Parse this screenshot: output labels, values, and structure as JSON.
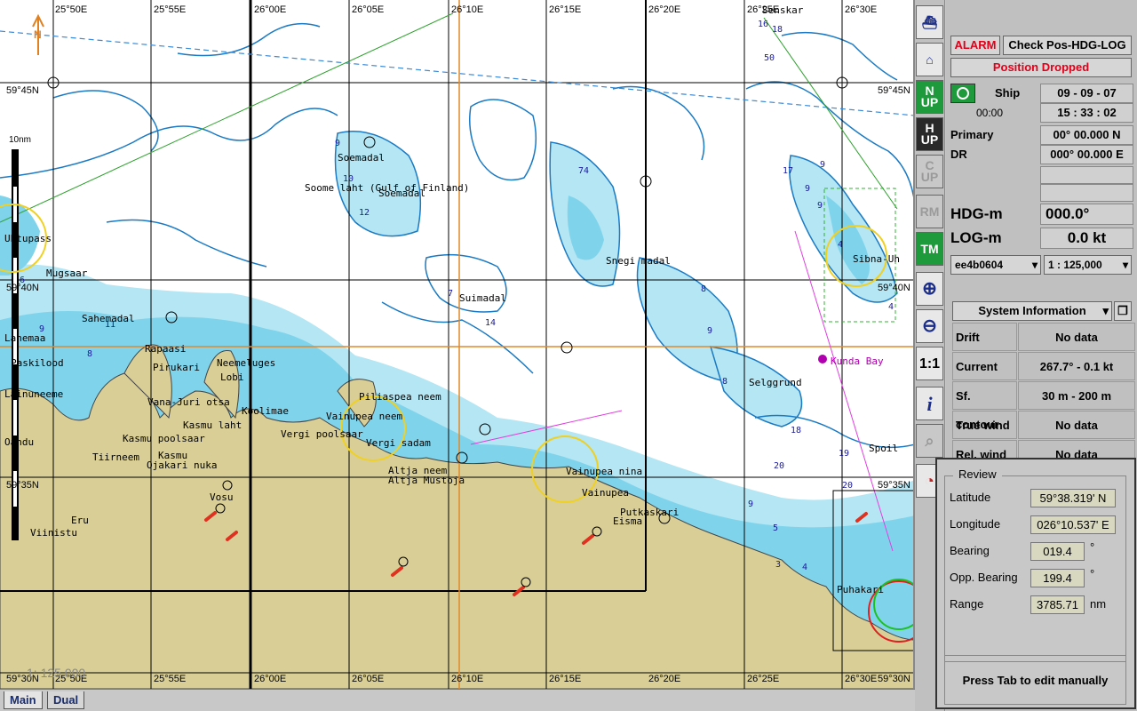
{
  "chart": {
    "top_longitudes": [
      "25°50E",
      "25°55E",
      "26°00E",
      "26°05E",
      "26°10E",
      "26°15E",
      "26°20E",
      "26°25E",
      "26°30E"
    ],
    "bottom_longitudes": [
      "25°50E",
      "25°55E",
      "26°00E",
      "26°05E",
      "26°10E",
      "26°15E",
      "26°20E",
      "26°25E",
      "26°30E"
    ],
    "left_latitudes": [
      "59°45N",
      "59°40N",
      "59°35N",
      "59°30N"
    ],
    "right_latitudes": [
      "59°45N",
      "59°40N",
      "59°35N",
      "59°30N"
    ],
    "scale_bar_label": "10nm",
    "scale_text": "1: 125,000",
    "places": [
      "Soemadal",
      "Soome laht (Gulf of Finland)",
      "Soemadal",
      "Snegi madal",
      "Suimadal",
      "Kunda Bay",
      "Selggrund",
      "Spoil",
      "Sibna-Uh",
      "Uhtupass",
      "Mugsaar",
      "Sahemadal",
      "Paskilood",
      "Rapaasi",
      "Pirukari",
      "Kasmu laht",
      "Kasmu poolsaar",
      "Neemeluges",
      "Lobi",
      "Vainupea neem",
      "Vergi poolsaar",
      "Vergi sadam",
      "Altja neem",
      "Altja Mustoja",
      "Vainupea nina",
      "Vainupea",
      "Putkaskari",
      "Eisma",
      "Puhakari",
      "Viinistu",
      "Tiirneem",
      "Ojakari nuka",
      "Vosu",
      "Eru",
      "Kasmu",
      "Lainuneeme",
      "Vana-Juri otsa",
      "Koolimae",
      "Piliaspea neem",
      "Lahemaa",
      "Oandu",
      "Senskar"
    ],
    "depths": [
      "16",
      "18",
      "50",
      "9",
      "10",
      "12",
      "74",
      "17",
      "4",
      "9",
      "8",
      "7",
      "14",
      "9",
      "8",
      "9",
      "4",
      "20",
      "19",
      "20",
      "18",
      "5",
      "3",
      "4",
      "9",
      "9",
      "11",
      "8",
      "9",
      "6"
    ]
  },
  "tabs": {
    "main": "Main",
    "dual": "Dual"
  },
  "tools": {
    "n_up": "N UP",
    "h_up": "H UP",
    "c_up": "C UP",
    "rm": "RM",
    "tm": "TM",
    "one_to_one": "1:1",
    "info": "i"
  },
  "panel": {
    "alarm_label": "ALARM",
    "alarm_message": "Check Pos-HDG-LOG",
    "position_status": "Position Dropped",
    "ship_label": "Ship",
    "ship_time_offset": "00:00",
    "date": "09 - 09 - 07",
    "time": "15 : 33 : 02",
    "primary_label": "Primary",
    "primary_value": "00° 00.000 N",
    "dr_label": "DR",
    "dr_value": "000° 00.000 E",
    "hdg_label": "HDG-m",
    "hdg_value": "000.0°",
    "log_label": "LOG-m",
    "log_value": "0.0 kt",
    "chart_id": "ee4b0604",
    "scale_select": "1 : 125,000",
    "system_info": "System Information",
    "info_rows": [
      {
        "label": "Drift",
        "value": "No data"
      },
      {
        "label": "Current",
        "value": "267.7° - 0.1 kt"
      },
      {
        "label": "Sf. contour",
        "value": "30 m - 200 m"
      },
      {
        "label": "True wind",
        "value": "No data"
      },
      {
        "label": "Rel. wind",
        "value": "No data"
      }
    ]
  },
  "review": {
    "title": "Review",
    "latitude_label": "Latitude",
    "latitude_value": "59°38.319' N",
    "longitude_label": "Longitude",
    "longitude_value": "026°10.537' E",
    "bearing_label": "Bearing",
    "bearing_value": "019.4",
    "bearing_unit": "°",
    "opp_bearing_label": "Opp. Bearing",
    "opp_bearing_value": "199.4",
    "opp_bearing_unit": "°",
    "range_label": "Range",
    "range_value": "3785.71",
    "range_unit": "nm",
    "hint": "Press Tab to edit manually"
  },
  "colors": {
    "land": "#d9cf96",
    "shallow": "#7fd4ec",
    "medium": "#b5e6f4",
    "deep": "#ffffff",
    "contour": "#1a7ac4",
    "alarm": "#e0001a",
    "tool_active": "#1e9a3c"
  }
}
